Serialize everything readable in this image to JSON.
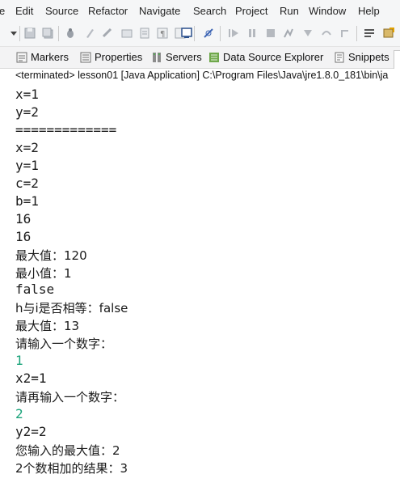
{
  "menu": [
    "e",
    "Edit",
    "Source",
    "Refactor",
    "Navigate",
    "Search",
    "Project",
    "Run",
    "Window",
    "Help"
  ],
  "tabs": [
    {
      "label": "Markers",
      "icon": "markers-icon"
    },
    {
      "label": "Properties",
      "icon": "properties-icon"
    },
    {
      "label": "Servers",
      "icon": "servers-icon"
    },
    {
      "label": "Data Source Explorer",
      "icon": "data-source-explorer-icon"
    },
    {
      "label": "Snippets",
      "icon": "snippets-icon"
    }
  ],
  "console": {
    "status": "<terminated> lesson01 [Java Application] C:\\Program Files\\Java\\jre1.8.0_181\\bin\\ja",
    "lines": [
      {
        "text": "x=1",
        "kind": "output"
      },
      {
        "text": "y=2",
        "kind": "output"
      },
      {
        "text": "=============",
        "kind": "output"
      },
      {
        "text": "x=2",
        "kind": "output"
      },
      {
        "text": "y=1",
        "kind": "output"
      },
      {
        "text": "c=2",
        "kind": "output"
      },
      {
        "text": "b=1",
        "kind": "output"
      },
      {
        "text": "16",
        "kind": "output"
      },
      {
        "text": "16",
        "kind": "output"
      },
      {
        "text": "最大值：120",
        "kind": "output"
      },
      {
        "text": "最小值：1",
        "kind": "output"
      },
      {
        "text": "false",
        "kind": "output"
      },
      {
        "text": "h与i是否相等：false",
        "kind": "output"
      },
      {
        "text": "最大值：13",
        "kind": "output"
      },
      {
        "text": "请输入一个数字：",
        "kind": "output"
      },
      {
        "text": "1",
        "kind": "input"
      },
      {
        "text": "x2=1",
        "kind": "output"
      },
      {
        "text": "请再输入一个数字：",
        "kind": "output"
      },
      {
        "text": "2",
        "kind": "input"
      },
      {
        "text": "y2=2",
        "kind": "output"
      },
      {
        "text": "您输入的最大值：2",
        "kind": "output"
      },
      {
        "text": "2个数相加的结果：3",
        "kind": "output"
      }
    ]
  },
  "colors": {
    "input_text": "#1aa37a",
    "output_text": "#1a1a1a",
    "chrome_bg": "#f5f6f7"
  }
}
